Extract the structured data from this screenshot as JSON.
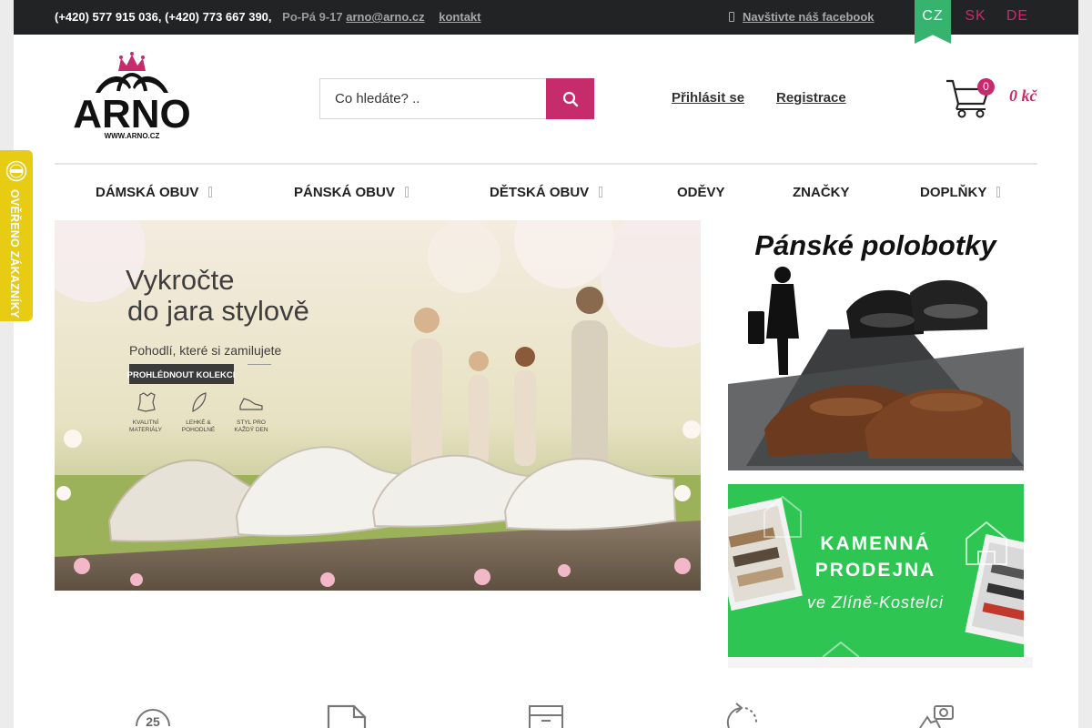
{
  "topbar": {
    "phones": "(+420) 577 915 036, (+420) 773 667 390,",
    "hours": "Po-Pá 9-17",
    "email": "arno@arno.cz",
    "contact_link": "kontakt",
    "facebook_link": "Navštivte náš facebook"
  },
  "languages": [
    {
      "code": "CZ",
      "active": true
    },
    {
      "code": "SK",
      "active": false
    },
    {
      "code": "DE",
      "active": false
    }
  ],
  "brand": {
    "name": "ARNO",
    "url_text": "WWW.ARNO.CZ",
    "primary_color": "#c62b6b",
    "accent_color": "#36b36f"
  },
  "search": {
    "placeholder": "Co hledáte? ..",
    "button_icon": "search-icon"
  },
  "account": {
    "login_label": "Přihlásit se",
    "register_label": "Registrace"
  },
  "cart": {
    "count": "0",
    "total": "0 kč",
    "icon": "cart-icon"
  },
  "nav": {
    "items": [
      {
        "label": "DÁMSKÁ OBUV",
        "has_submenu": true
      },
      {
        "label": "PÁNSKÁ OBUV",
        "has_submenu": true
      },
      {
        "label": "DĚTSKÁ OBUV",
        "has_submenu": true
      },
      {
        "label": "ODĚVY",
        "has_submenu": false
      },
      {
        "label": "ZNAČKY",
        "has_submenu": false
      },
      {
        "label": "DOPLŇKY",
        "has_submenu": true
      }
    ]
  },
  "verified_badge": {
    "label": "OVĚŘENO ZÁKAZNÍKY",
    "color": "#e8cc14"
  },
  "hero": {
    "headline_line1": "Vykročte",
    "headline_line2": "do jara stylově",
    "subheadline": "Pohodlí, které si zamilujete",
    "cta_label": "PROHLÉDNOUT KOLEKCI",
    "features": [
      {
        "icon": "leather-icon",
        "line1": "KVALITNÍ",
        "line2": "MATERIÁLY"
      },
      {
        "icon": "feather-icon",
        "line1": "LEHKÉ &",
        "line2": "POHODLNÉ"
      },
      {
        "icon": "shoe-icon",
        "line1": "STYL PRO",
        "line2": "KAŽDÝ DEN"
      }
    ]
  },
  "promo_men": {
    "title": "Pánské polobotky"
  },
  "promo_store": {
    "line1": "KAMENNÁ",
    "line2": "PRODEJNA",
    "line3": "ve Zlíně-Kostelci",
    "color": "#2fc553"
  },
  "service_icons": [
    {
      "icon": "clock-25-icon",
      "value": "25"
    },
    {
      "icon": "document-icon"
    },
    {
      "icon": "box-icon"
    },
    {
      "icon": "return-icon"
    },
    {
      "icon": "location-camera-icon"
    }
  ]
}
